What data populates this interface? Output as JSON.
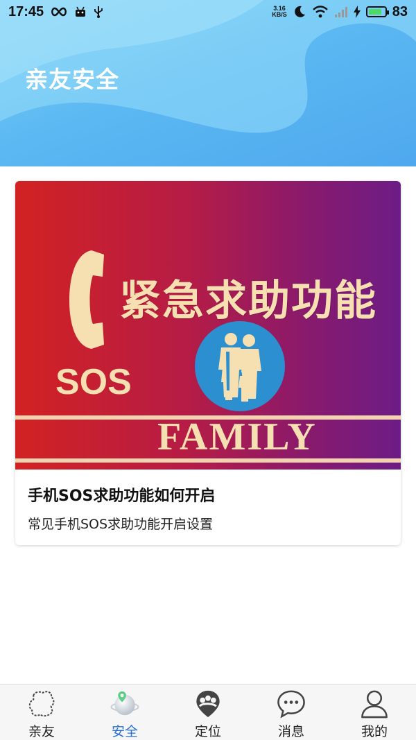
{
  "status_bar": {
    "time": "17:45",
    "net_speed_value": "3.16",
    "net_speed_unit": "KB/S",
    "battery": "83",
    "icons": [
      "infinity-icon",
      "android-icon",
      "usb-icon",
      "moon-icon",
      "wifi-icon",
      "signal-icon",
      "charging-icon",
      "battery-icon"
    ]
  },
  "header": {
    "title": "亲友安全"
  },
  "card": {
    "banner": {
      "headline": "紧急求助功能",
      "sos": "SOS",
      "family": "FAMILY"
    },
    "title": "手机SOS求助功能如何开启",
    "subtitle": "常见手机SOS求助功能开启设置"
  },
  "nav": {
    "items": [
      {
        "label": "亲友",
        "icon": "friends-icon",
        "active": false
      },
      {
        "label": "安全",
        "icon": "safety-globe-icon",
        "active": true
      },
      {
        "label": "定位",
        "icon": "location-icon",
        "active": false
      },
      {
        "label": "消息",
        "icon": "message-icon",
        "active": false
      },
      {
        "label": "我的",
        "icon": "profile-icon",
        "active": false
      }
    ]
  },
  "colors": {
    "accent": "#2a6fd6",
    "header": "#5cb9f2",
    "banner_text": "#f6dfb0"
  }
}
